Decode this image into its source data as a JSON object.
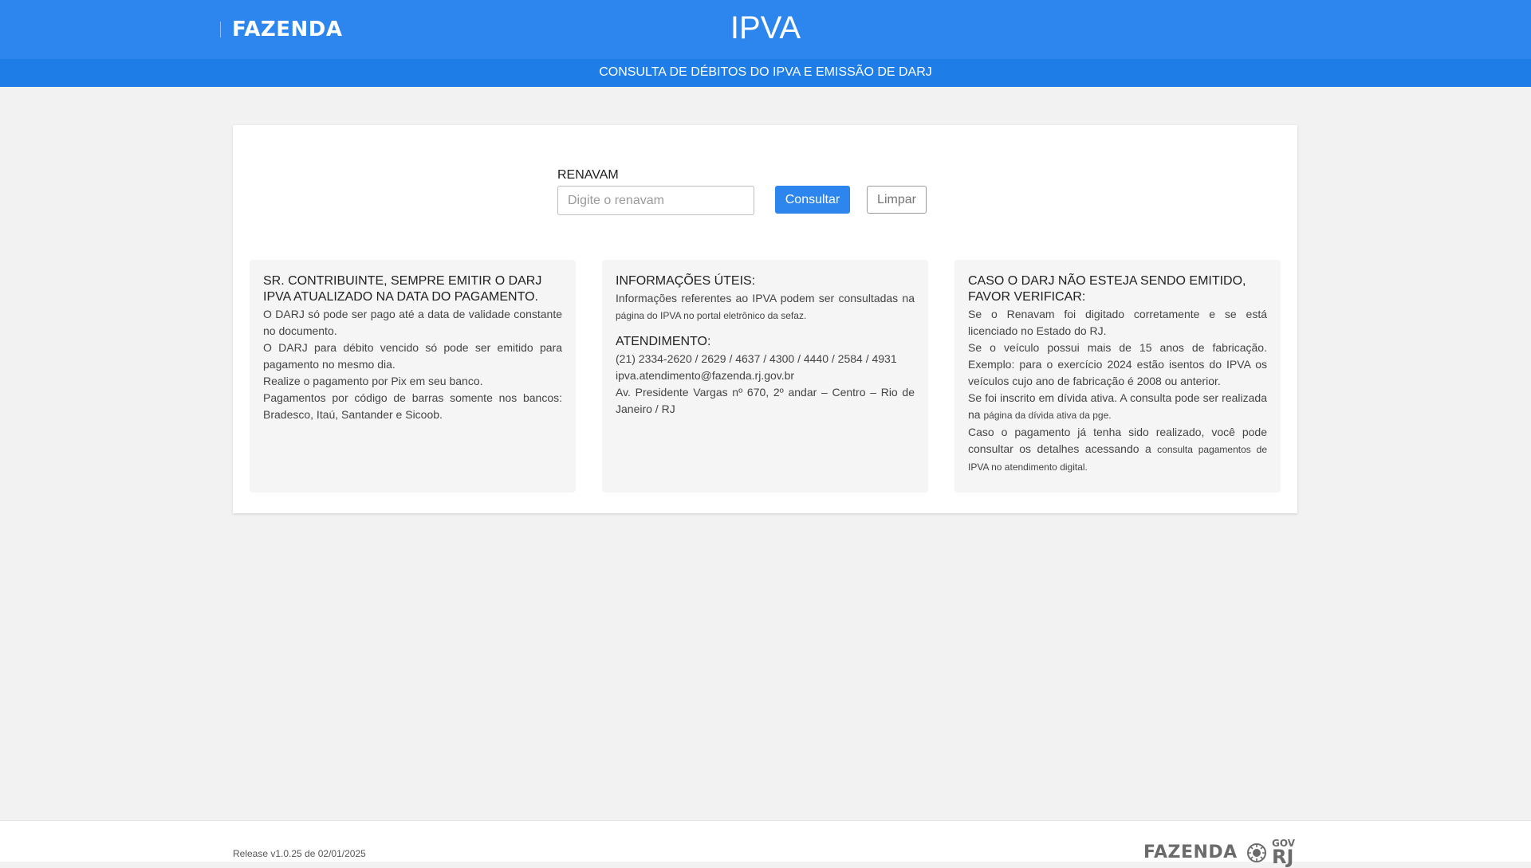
{
  "header": {
    "logo": "FAZENDA",
    "title": "IPVA",
    "subtitle": "CONSULTA DE DÉBITOS DO IPVA E EMISSÃO DE DARJ"
  },
  "form": {
    "label": "RENAVAM",
    "placeholder": "Digite o renavam",
    "value": "",
    "consultar_label": "Consultar",
    "limpar_label": "Limpar"
  },
  "box1": {
    "title": "SR. CONTRIBUINTE, SEMPRE EMITIR O DARJ IPVA ATUALIZADO NA DATA DO PAGAMENTO.",
    "p1": "O DARJ só pode ser pago até a data de validade constante no documento.",
    "p2": "O DARJ para débito vencido só pode ser emitido para pagamento no mesmo dia.",
    "p3": "Realize o pagamento por Pix em seu banco.",
    "p4": "Pagamentos por código de barras somente nos bancos: Bradesco, Itaú, Santander e Sicoob."
  },
  "box2": {
    "title": "INFORMAÇÕES ÚTEIS:",
    "p1_text": "Informações referentes ao IPVA podem ser consultadas na",
    "p1_link": "página do IPVA no portal eletrônico da sefaz",
    "title2": "ATENDIMENTO:",
    "phones": "(21) 2334-2620 / 2629 / 4637 / 4300 / 4440 / 2584 / 4931",
    "email": "ipva.atendimento@fazenda.rj.gov.br",
    "address": "Av. Presidente Vargas nº 670, 2º andar – Centro – Rio de Janeiro / RJ"
  },
  "box3": {
    "title": "CASO O DARJ NÃO ESTEJA SENDO EMITIDO, FAVOR VERIFICAR:",
    "p1": "Se o Renavam foi digitado corretamente e se está licenciado no Estado do RJ.",
    "p2": "Se o veículo possui mais de 15 anos de fabricação. Exemplo: para o exercício 2024 estão isentos do IPVA os veículos cujo ano de fabricação é 2008 ou anterior.",
    "p3_text": "Se foi inscrito em dívida ativa. A consulta pode ser realizada na",
    "p3_link": "página da dívida ativa da pge",
    "p4_text": "Caso o pagamento já tenha sido realizado, você pode consultar os detalhes acessando a",
    "p4_link": "consulta pagamentos de IPVA no atendimento digital"
  },
  "footer": {
    "release": "Release v1.0.25 de 02/01/2025",
    "logo": "FAZENDA",
    "gov": "GOV",
    "rj": "RJ"
  },
  "colors": {
    "header": "#2d86ee",
    "subheader": "#1e7de6",
    "background": "#f2f2f2"
  }
}
